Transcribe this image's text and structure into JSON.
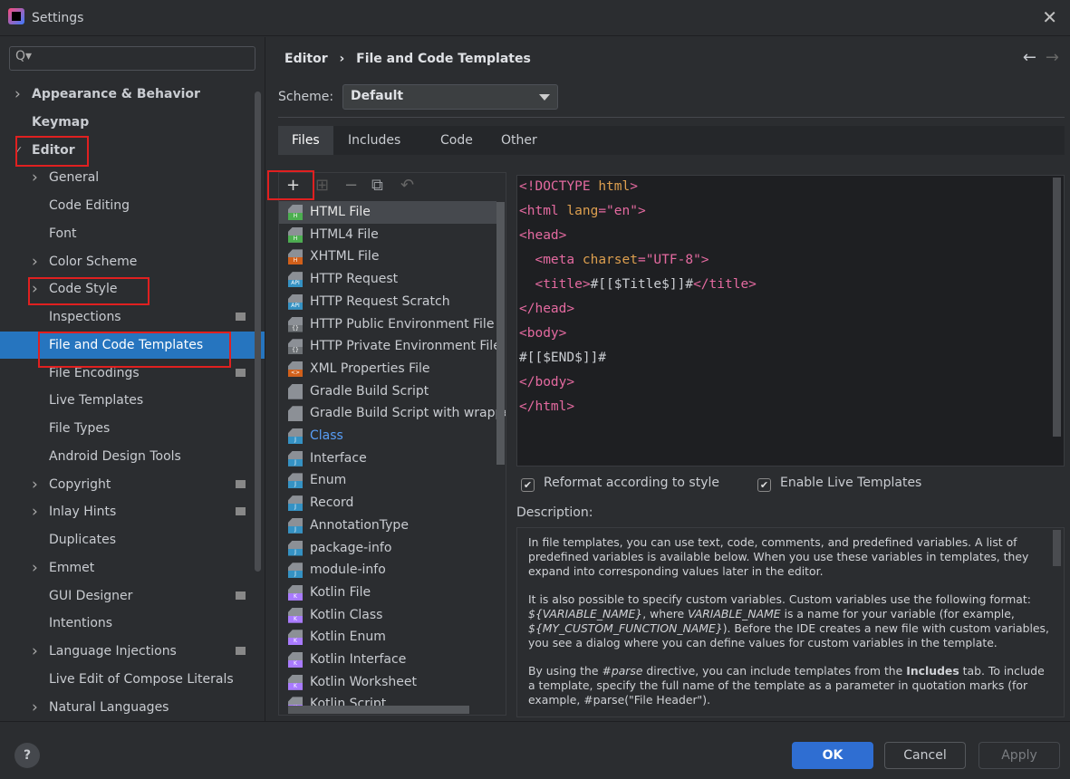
{
  "window": {
    "title": "Settings",
    "close_icon": "close-icon",
    "logo": "JetBrains IDE logo"
  },
  "sidebar": {
    "search_placeholder": "Q▾",
    "items": [
      {
        "label": "Appearance & Behavior",
        "level": 0,
        "expandable": true,
        "bold": true
      },
      {
        "label": "Keymap",
        "level": 0,
        "bold": true
      },
      {
        "label": "Editor",
        "level": 0,
        "expanded": true,
        "bold": true
      },
      {
        "label": "General",
        "level": 1,
        "expandable": true
      },
      {
        "label": "Code Editing",
        "level": 1
      },
      {
        "label": "Font",
        "level": 1
      },
      {
        "label": "Color Scheme",
        "level": 1,
        "expandable": true
      },
      {
        "label": "Code Style",
        "level": 1,
        "expandable": true
      },
      {
        "label": "Inspections",
        "level": 1,
        "badge": true
      },
      {
        "label": "File and Code Templates",
        "level": 1,
        "selected": true
      },
      {
        "label": "File Encodings",
        "level": 1,
        "badge": true
      },
      {
        "label": "Live Templates",
        "level": 1
      },
      {
        "label": "File Types",
        "level": 1
      },
      {
        "label": "Android Design Tools",
        "level": 1
      },
      {
        "label": "Copyright",
        "level": 1,
        "expandable": true,
        "badge": true
      },
      {
        "label": "Inlay Hints",
        "level": 1,
        "expandable": true,
        "badge": true
      },
      {
        "label": "Duplicates",
        "level": 1
      },
      {
        "label": "Emmet",
        "level": 1,
        "expandable": true
      },
      {
        "label": "GUI Designer",
        "level": 1,
        "badge": true
      },
      {
        "label": "Intentions",
        "level": 1
      },
      {
        "label": "Language Injections",
        "level": 1,
        "expandable": true,
        "badge": true
      },
      {
        "label": "Live Edit of Compose Literals",
        "level": 1
      },
      {
        "label": "Natural Languages",
        "level": 1,
        "expandable": true
      }
    ]
  },
  "breadcrumb": {
    "parent": "Editor",
    "separator": "›",
    "current": "File and Code Templates"
  },
  "nav": {
    "back": "←",
    "forward": "→"
  },
  "scheme": {
    "label": "Scheme:",
    "value": "Default"
  },
  "tabs": [
    {
      "label": "Files",
      "selected": true
    },
    {
      "label": "Includes"
    },
    {
      "label": "Code"
    },
    {
      "label": "Other"
    }
  ],
  "toolbar": {
    "add": "+",
    "add_child": "⊞",
    "remove": "−",
    "copy": "⧉",
    "reset": "↶"
  },
  "templates": [
    {
      "label": "HTML File",
      "icon": "H",
      "color": "#4caf50",
      "selected": true
    },
    {
      "label": "HTML4 File",
      "icon": "H",
      "color": "#4caf50"
    },
    {
      "label": "XHTML File",
      "icon": "H",
      "color": "#d2601a"
    },
    {
      "label": "HTTP Request",
      "icon": "API",
      "color": "#3592c4"
    },
    {
      "label": "HTTP Request Scratch",
      "icon": "API",
      "color": "#3592c4"
    },
    {
      "label": "HTTP Public Environment File",
      "icon": "{}",
      "color": "#6e7276"
    },
    {
      "label": "HTTP Private Environment File",
      "icon": "{}",
      "color": "#6e7276"
    },
    {
      "label": "XML Properties File",
      "icon": "<>",
      "color": "#d2601a"
    },
    {
      "label": "Gradle Build Script",
      "icon": "gradle",
      "color": "#8c9096"
    },
    {
      "label": "Gradle Build Script with wrapper",
      "icon": "gradle",
      "color": "#8c9096"
    },
    {
      "label": "Class",
      "icon": "J",
      "color": "#3592c4",
      "highlight": "#589df6"
    },
    {
      "label": "Interface",
      "icon": "J",
      "color": "#3592c4"
    },
    {
      "label": "Enum",
      "icon": "J",
      "color": "#3592c4"
    },
    {
      "label": "Record",
      "icon": "J",
      "color": "#3592c4"
    },
    {
      "label": "AnnotationType",
      "icon": "J",
      "color": "#3592c4"
    },
    {
      "label": "package-info",
      "icon": "J",
      "color": "#3592c4"
    },
    {
      "label": "module-info",
      "icon": "J",
      "color": "#3592c4"
    },
    {
      "label": "Kotlin File",
      "icon": "K",
      "color": "#a97bff"
    },
    {
      "label": "Kotlin Class",
      "icon": "K",
      "color": "#a97bff"
    },
    {
      "label": "Kotlin Enum",
      "icon": "K",
      "color": "#a97bff"
    },
    {
      "label": "Kotlin Interface",
      "icon": "K",
      "color": "#a97bff"
    },
    {
      "label": "Kotlin Worksheet",
      "icon": "K",
      "color": "#a97bff"
    },
    {
      "label": "Kotlin Script",
      "icon": "K",
      "color": "#a97bff"
    }
  ],
  "code": [
    [
      [
        "tg",
        "<!DOCTYPE "
      ],
      [
        "at",
        "html"
      ],
      [
        "tg",
        ">"
      ]
    ],
    [
      [
        "tg",
        "<html "
      ],
      [
        "at",
        "lang"
      ],
      [
        "tg",
        "=\"en\">"
      ]
    ],
    [
      [
        "tg",
        "<head>"
      ]
    ],
    [
      [
        "tx",
        "  "
      ],
      [
        "tg",
        "<meta "
      ],
      [
        "at",
        "charset"
      ],
      [
        "tg",
        "=\"UTF-8\">"
      ]
    ],
    [
      [
        "tx",
        "  "
      ],
      [
        "tg",
        "<title>"
      ],
      [
        "tx",
        "#[[$Title$]]#"
      ],
      [
        "tg",
        "</title>"
      ]
    ],
    [
      [
        "tg",
        "</head>"
      ]
    ],
    [
      [
        "tg",
        "<body>"
      ]
    ],
    [
      [
        "tx",
        "#[[$END$]]#"
      ]
    ],
    [
      [
        "tg",
        "</body>"
      ]
    ],
    [
      [
        "tg",
        "</html>"
      ]
    ]
  ],
  "options": {
    "reformat": {
      "label": "Reformat according to style",
      "checked": true
    },
    "live": {
      "label": "Enable Live Templates",
      "checked": true
    }
  },
  "description": {
    "label": "Description:",
    "p1": "In file templates, you can use text, code, comments, and predefined variables. A list of predefined variables is available below. When you use these variables in templates, they expand into corresponding values later in the editor.",
    "p2a": "It is also possible to specify custom variables. Custom variables use the following format: ",
    "p2v1": "${VARIABLE_NAME}",
    "p2b": ", where ",
    "p2v2": "VARIABLE_NAME",
    "p2c": " is a name for your variable (for example, ",
    "p2v3": "${MY_CUSTOM_FUNCTION_NAME}",
    "p2d": "). Before the IDE creates a new file with custom variables, you see a dialog where you can define values for custom variables in the template.",
    "p3a": "By using the ",
    "p3v": "#parse",
    "p3b": " directive, you can include templates from the ",
    "p3c": "Includes",
    "p3d": " tab. To include a template, specify the full name of the template as a parameter in quotation marks (for example, #parse(\"File Header\")."
  },
  "footer": {
    "help": "?",
    "ok": "OK",
    "cancel": "Cancel",
    "apply": "Apply"
  },
  "colors": {
    "selection": "#2675bf",
    "ok": "#2f6ed2",
    "annotation_box": "#e02020"
  }
}
